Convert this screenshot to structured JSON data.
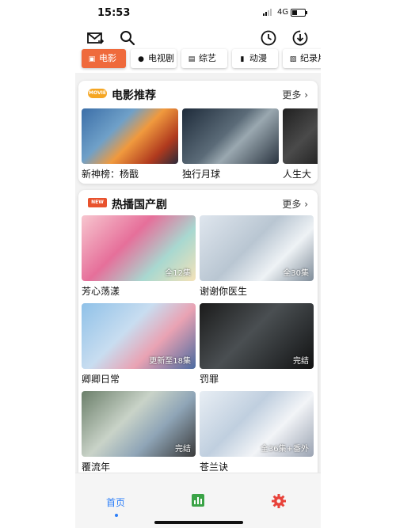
{
  "status_bar": {
    "time": "15:53",
    "network": "4G"
  },
  "tabs": [
    {
      "label": "电影",
      "icon": "film-icon",
      "active": true
    },
    {
      "label": "电视剧",
      "icon": "tv-icon",
      "active": false
    },
    {
      "label": "综艺",
      "icon": "variety-icon",
      "active": false
    },
    {
      "label": "动漫",
      "icon": "anime-icon",
      "active": false
    },
    {
      "label": "纪录片",
      "icon": "documentary-icon",
      "active": false
    }
  ],
  "movie_section": {
    "badge": "MOVIE",
    "title": "电影推荐",
    "more": "更多",
    "items": [
      {
        "title": "新神榜：杨戬"
      },
      {
        "title": "独行月球"
      },
      {
        "title": "人生大"
      }
    ]
  },
  "drama_section": {
    "badge": "NEW",
    "title": "热播国产剧",
    "more": "更多",
    "items": [
      {
        "title": "芳心荡漾",
        "episodes": "全12集"
      },
      {
        "title": "谢谢你医生",
        "episodes": "全30集"
      },
      {
        "title": "卿卿日常",
        "episodes": "更新至18集"
      },
      {
        "title": "罚罪",
        "episodes": "完结"
      },
      {
        "title": "覆流年",
        "episodes": "完结"
      },
      {
        "title": "苍兰诀",
        "episodes": "全36集+番外"
      }
    ]
  },
  "bottom_nav": {
    "home_label": "首页"
  },
  "colors": {
    "accent": "#ef6a3c",
    "nav_active": "#2d7ff9",
    "settings": "#e8433b",
    "chart": "#3aa346"
  }
}
